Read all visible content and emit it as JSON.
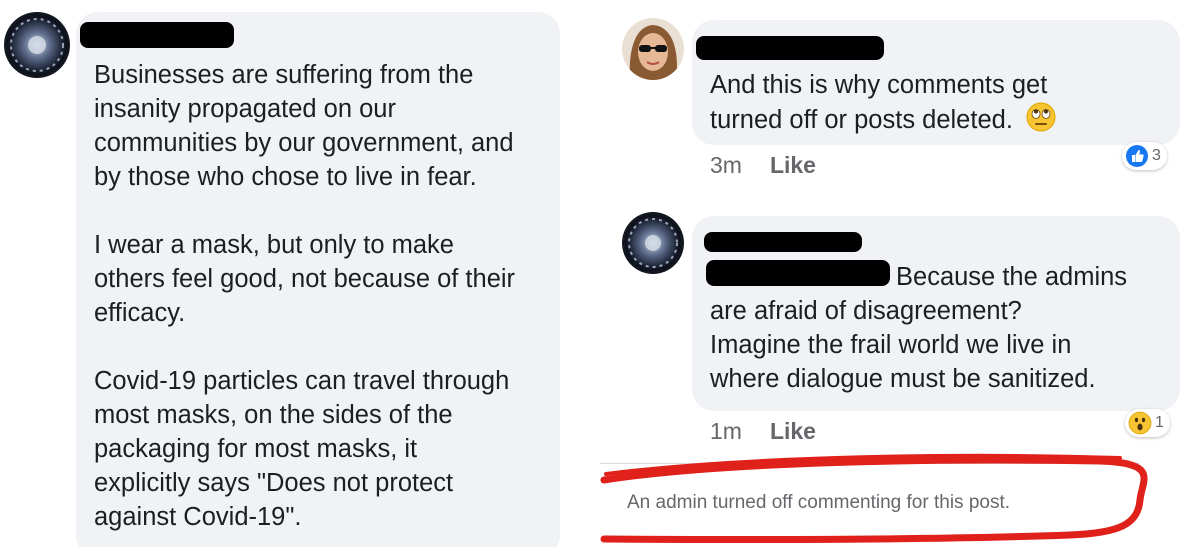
{
  "left_comment": {
    "paragraphs": [
      [
        "Businesses are suffering from the",
        "insanity propagated on our",
        "communities by our government, and",
        "by those who chose to live in fear."
      ],
      [
        "I wear a mask, but only to make",
        "others feel good, not because of their",
        "efficacy."
      ],
      [
        "Covid-19 particles can travel through",
        "most masks, on the sides of the",
        "packaging for most masks, it",
        "explicitly says \"Does not protect",
        "against Covid-19\"."
      ]
    ]
  },
  "right_comment_1": {
    "lines": [
      "And this is why comments get",
      "turned off or posts deleted."
    ],
    "emoji_icon": "eye-roll-emoji-icon",
    "time": "3m",
    "like_label": "Like",
    "reaction_icon": "thumbs-up-reaction-icon",
    "reaction_count": "3"
  },
  "right_comment_2": {
    "first_line": "Because the admins",
    "lines": [
      "are afraid of disagreement?",
      "Imagine the frail world we live in",
      "where dialogue must be sanitized."
    ],
    "time": "1m",
    "like_label": "Like",
    "reaction_icon": "wow-reaction-icon",
    "reaction_count": "1"
  },
  "notice": {
    "text": "An admin turned off commenting for this post.",
    "highlight_color": "#e0201b"
  },
  "colors": {
    "bubble": "#f0f2f5",
    "secondary_text": "#65676b",
    "like_blue": "#1877f2"
  }
}
